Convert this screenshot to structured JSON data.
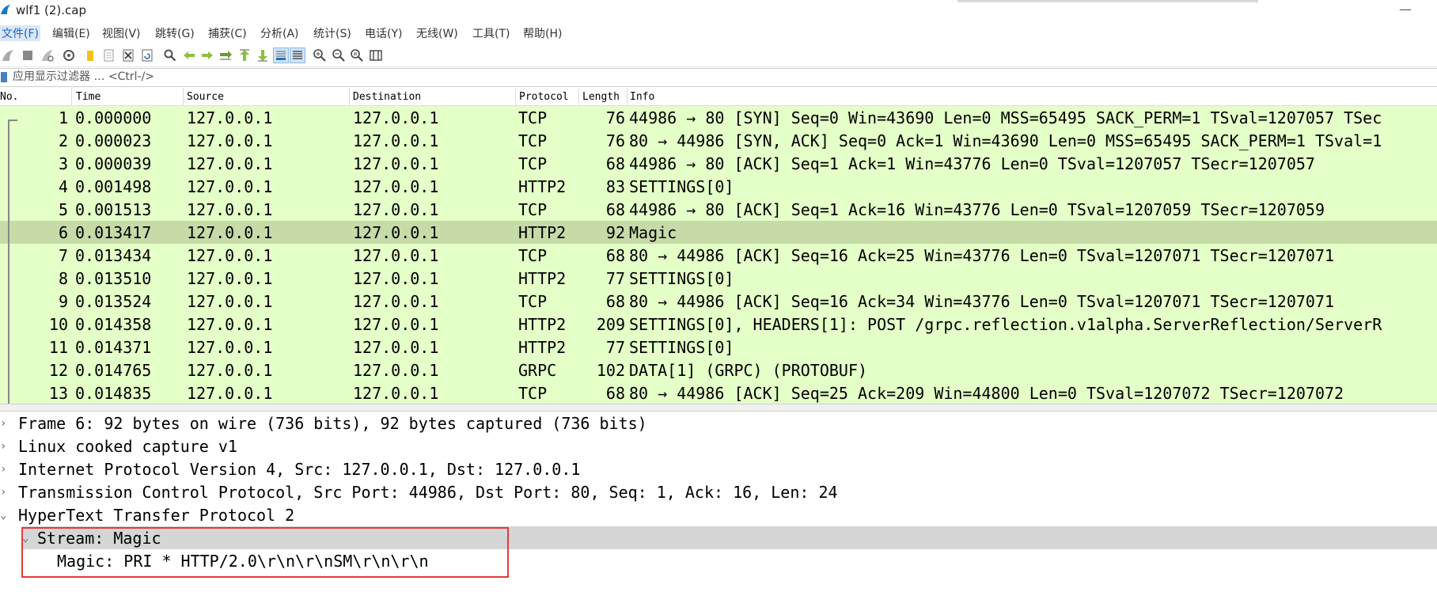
{
  "window": {
    "title": "wlf1 (2).cap"
  },
  "menu": [
    "文件(F)",
    "编辑(E)",
    "视图(V)",
    "跳转(G)",
    "捕获(C)",
    "分析(A)",
    "统计(S)",
    "电话(Y)",
    "无线(W)",
    "工具(T)",
    "帮助(H)"
  ],
  "filter": {
    "placeholder": "应用显示过滤器 … <Ctrl-/>"
  },
  "columns": [
    "No.",
    "Time",
    "Source",
    "Destination",
    "Protocol",
    "Length",
    "Info"
  ],
  "packets": [
    {
      "no": "1",
      "time": "0.000000",
      "src": "127.0.0.1",
      "dst": "127.0.0.1",
      "proto": "TCP",
      "len": "76",
      "info": "44986 → 80 [SYN] Seq=0 Win=43690 Len=0 MSS=65495 SACK_PERM=1 TSval=1207057 TSec"
    },
    {
      "no": "2",
      "time": "0.000023",
      "src": "127.0.0.1",
      "dst": "127.0.0.1",
      "proto": "TCP",
      "len": "76",
      "info": "80 → 44986 [SYN, ACK] Seq=0 Ack=1 Win=43690 Len=0 MSS=65495 SACK_PERM=1 TSval=1"
    },
    {
      "no": "3",
      "time": "0.000039",
      "src": "127.0.0.1",
      "dst": "127.0.0.1",
      "proto": "TCP",
      "len": "68",
      "info": "44986 → 80 [ACK] Seq=1 Ack=1 Win=43776 Len=0 TSval=1207057 TSecr=1207057"
    },
    {
      "no": "4",
      "time": "0.001498",
      "src": "127.0.0.1",
      "dst": "127.0.0.1",
      "proto": "HTTP2",
      "len": "83",
      "info": "SETTINGS[0]"
    },
    {
      "no": "5",
      "time": "0.001513",
      "src": "127.0.0.1",
      "dst": "127.0.0.1",
      "proto": "TCP",
      "len": "68",
      "info": "44986 → 80 [ACK] Seq=1 Ack=16 Win=43776 Len=0 TSval=1207059 TSecr=1207059"
    },
    {
      "no": "6",
      "time": "0.013417",
      "src": "127.0.0.1",
      "dst": "127.0.0.1",
      "proto": "HTTP2",
      "len": "92",
      "info": "Magic"
    },
    {
      "no": "7",
      "time": "0.013434",
      "src": "127.0.0.1",
      "dst": "127.0.0.1",
      "proto": "TCP",
      "len": "68",
      "info": "80 → 44986 [ACK] Seq=16 Ack=25 Win=43776 Len=0 TSval=1207071 TSecr=1207071"
    },
    {
      "no": "8",
      "time": "0.013510",
      "src": "127.0.0.1",
      "dst": "127.0.0.1",
      "proto": "HTTP2",
      "len": "77",
      "info": "SETTINGS[0]"
    },
    {
      "no": "9",
      "time": "0.013524",
      "src": "127.0.0.1",
      "dst": "127.0.0.1",
      "proto": "TCP",
      "len": "68",
      "info": "80 → 44986 [ACK] Seq=16 Ack=34 Win=43776 Len=0 TSval=1207071 TSecr=1207071"
    },
    {
      "no": "10",
      "time": "0.014358",
      "src": "127.0.0.1",
      "dst": "127.0.0.1",
      "proto": "HTTP2",
      "len": "209",
      "info": "SETTINGS[0], HEADERS[1]: POST /grpc.reflection.v1alpha.ServerReflection/ServerR"
    },
    {
      "no": "11",
      "time": "0.014371",
      "src": "127.0.0.1",
      "dst": "127.0.0.1",
      "proto": "HTTP2",
      "len": "77",
      "info": "SETTINGS[0]"
    },
    {
      "no": "12",
      "time": "0.014765",
      "src": "127.0.0.1",
      "dst": "127.0.0.1",
      "proto": "GRPC",
      "len": "102",
      "info": "DATA[1] (GRPC) (PROTOBUF)"
    },
    {
      "no": "13",
      "time": "0.014835",
      "src": "127.0.0.1",
      "dst": "127.0.0.1",
      "proto": "TCP",
      "len": "68",
      "info": "80 → 44986 [ACK] Seq=25 Ack=209 Win=44800 Len=0 TSval=1207072 TSecr=1207072"
    }
  ],
  "selected_packet": "6",
  "details": [
    {
      "text": "Frame 6: 92 bytes on wire (736 bits), 92 bytes captured (736 bits)",
      "level": 0,
      "expanded": false
    },
    {
      "text": "Linux cooked capture v1",
      "level": 0,
      "expanded": false
    },
    {
      "text": "Internet Protocol Version 4, Src: 127.0.0.1, Dst: 127.0.0.1",
      "level": 0,
      "expanded": false
    },
    {
      "text": "Transmission Control Protocol, Src Port: 44986, Dst Port: 80, Seq: 1, Ack: 16, Len: 24",
      "level": 0,
      "expanded": false
    },
    {
      "text": "HyperText Transfer Protocol 2",
      "level": 0,
      "expanded": true
    },
    {
      "text": "Stream: Magic",
      "level": 1,
      "expanded": true
    },
    {
      "text": "Magic: PRI * HTTP/2.0\\r\\n\\r\\nSM\\r\\n\\r\\n",
      "level": 2,
      "expanded": null
    }
  ],
  "colors": {
    "tcp_row": "#e4ffc7",
    "selected_row": "#c6dba8",
    "highlight_box": "#e33b3b"
  }
}
